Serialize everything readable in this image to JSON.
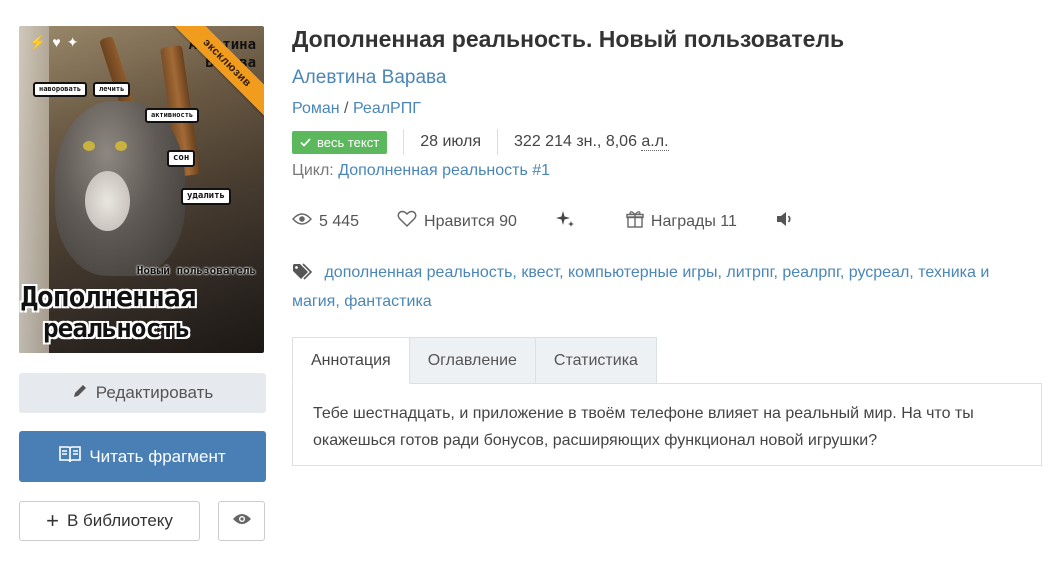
{
  "cover": {
    "ribbon": "эксклюзив",
    "author_line1": "Алевтина",
    "author_line2": "Варава",
    "subtitle": "Новый пользователь",
    "title_line1": "Дополненная",
    "title_line2": "реальность",
    "bubbles": [
      "наворовать",
      "лечить",
      "активность",
      "сон",
      "удалить"
    ]
  },
  "buttons": {
    "edit": "Редактировать",
    "read": "Читать фрагмент",
    "library": "В библиотеку"
  },
  "book": {
    "title": "Дополненная реальность. Новый пользователь",
    "author": "Алевтина Варава",
    "genre1": "Роман",
    "genre_sep": " / ",
    "genre2": "РеалРПГ",
    "badge": "весь текст",
    "date": "28 июля",
    "size_prefix": "322 214 зн., 8,06 ",
    "size_unit": "а.л.",
    "cycle_label": "Цикл:",
    "cycle_name": "Дополненная реальность",
    "cycle_number": "#1"
  },
  "stats": {
    "views": "5 445",
    "likes_label": "Нравится",
    "likes": "90",
    "awards_label": "Награды",
    "awards": "11"
  },
  "tags": [
    "дополненная реальность",
    "квест",
    "компьютерные игры",
    "литрпг",
    "реалрпг",
    "русреал",
    "техника и магия",
    "фантастика"
  ],
  "tabs": [
    "Аннотация",
    "Оглавление",
    "Статистика"
  ],
  "annotation": "Тебе шестнадцать, и приложение в твоём телефоне влияет на реальный мир. На что ты окажешься готов ради бонусов, расширяющих функционал новой игрушки?",
  "colors": {
    "link": "#4a86b8",
    "primary": "#4a7fb5",
    "success": "#5bb85c",
    "ribbon": "#f29c1e"
  }
}
